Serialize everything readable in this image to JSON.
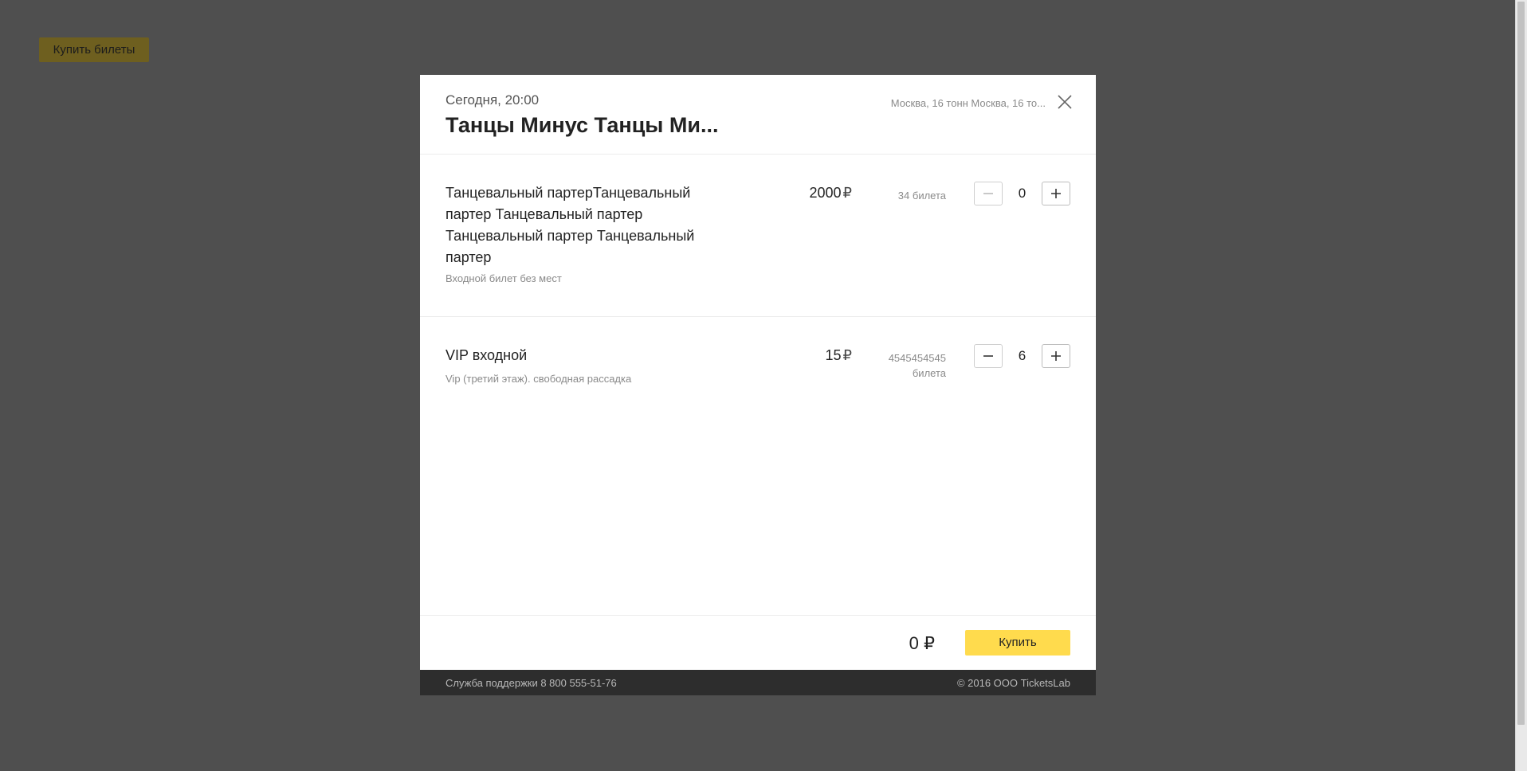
{
  "background": {
    "buy_tickets_label": "Купить билеты"
  },
  "modal": {
    "date": "Сегодня, 20:00",
    "title": "Танцы Минус Танцы Ми...",
    "venue": "Москва, 16 тонн Москва, 16 то...",
    "tickets": [
      {
        "name": "Танцевальный партерТанцевальный партер Танцевальный партер Танцевальный партер Танцевальный партер",
        "description": "Входной билет без мест",
        "price": "2000",
        "currency": "₽",
        "availability": "34 билета",
        "quantity": "0"
      },
      {
        "name": "VIP входной",
        "description": "Vip (третий этаж). свободная рассадка",
        "price": "15",
        "currency": "₽",
        "availability": "4545454545 билета",
        "quantity": "6"
      }
    ],
    "footer": {
      "total": "0 ₽",
      "buy_label": "Купить"
    },
    "support": {
      "phone_text": "Служба поддержки 8 800 555-51-76",
      "copyright": "© 2016 ООО TicketsLab"
    }
  },
  "colors": {
    "overlay": "#4f4f4f",
    "accent": "#ffdb4d",
    "support_bar": "#2d2d2d"
  }
}
